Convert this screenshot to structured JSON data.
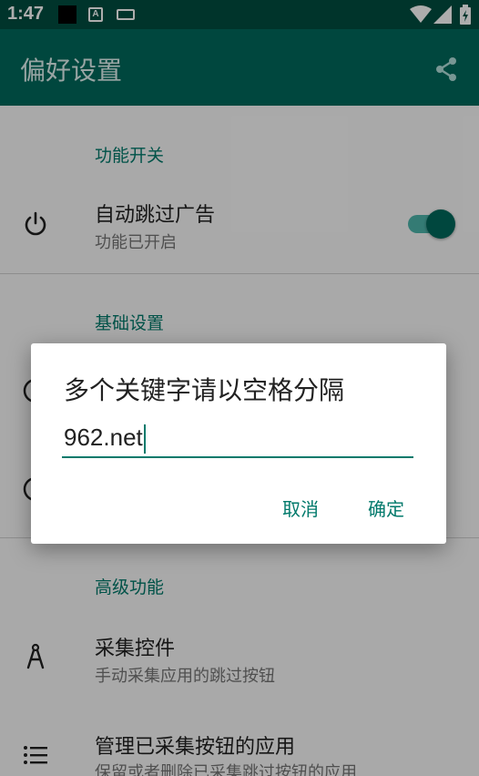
{
  "status_bar": {
    "time": "1:47",
    "a_icon": "A"
  },
  "app_bar": {
    "title": "偏好设置"
  },
  "sections": [
    {
      "category": "功能开关",
      "items": [
        {
          "title": "自动跳过广告",
          "summary": "功能已开启",
          "icon": "power-icon",
          "switch_on": true
        }
      ]
    },
    {
      "category": "基础设置"
    },
    {
      "category": "高级功能",
      "items": [
        {
          "title": "采集控件",
          "summary": "手动采集应用的跳过按钮",
          "icon": "compass-icon"
        },
        {
          "title": "管理已采集按钮的应用",
          "summary": "保留或者删除已采集跳过按钮的应用",
          "icon": "list-icon"
        }
      ]
    }
  ],
  "dialog": {
    "title": "多个关键字请以空格分隔",
    "input_value": "962.net",
    "cancel_label": "取消",
    "ok_label": "确定"
  },
  "colors": {
    "primary": "#00695c",
    "primary_dark": "#004d40",
    "accent": "#00796b"
  }
}
